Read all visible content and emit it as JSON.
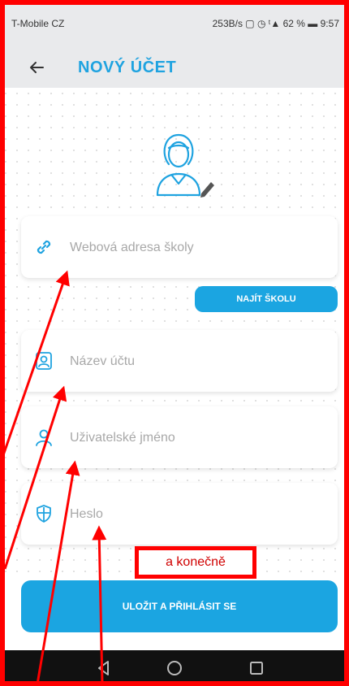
{
  "status": {
    "carrier": "T-Mobile CZ",
    "right": "253B/s ▢ ◷ ᵗ▲ 62 % ▬ 9:57"
  },
  "header": {
    "title": "NOVÝ ÚČET"
  },
  "fields": {
    "school_url": {
      "placeholder": "Webová adresa školy"
    },
    "account_name": {
      "placeholder": "Název účtu"
    },
    "username": {
      "placeholder": "Uživatelské jméno"
    },
    "password": {
      "placeholder": "Heslo"
    }
  },
  "buttons": {
    "find_school": "NAJÍT ŠKOLU",
    "save_login": "ULOŽIT A PŘIHLÁSIT SE"
  },
  "annotation": {
    "text": "a konečně"
  },
  "colors": {
    "accent": "#1ba5e1",
    "annotation": "#ff0000"
  }
}
